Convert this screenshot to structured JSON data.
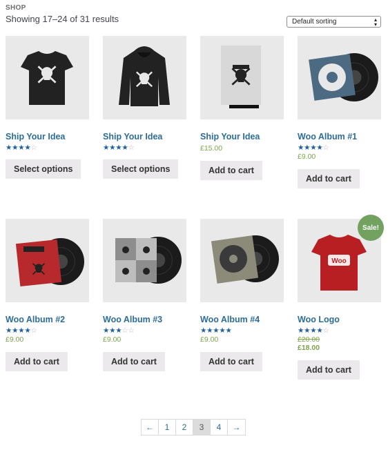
{
  "breadcrumb": "SHOP",
  "result_count": "Showing 17–24 of 31 results",
  "sort": {
    "selected": "Default sorting"
  },
  "sale_badge": "Sale!",
  "products": [
    {
      "name": "Ship Your Idea",
      "rating": 4.5,
      "price": "",
      "button": "Select options",
      "image": "black-tshirt"
    },
    {
      "name": "Ship Your Idea",
      "rating": 4,
      "price": "",
      "button": "Select options",
      "image": "black-hoodie"
    },
    {
      "name": "Ship Your Idea",
      "rating": 0,
      "price": "£15.00",
      "button": "Add to cart",
      "image": "poster"
    },
    {
      "name": "Woo Album #1",
      "rating": 4,
      "price": "£9.00",
      "button": "Add to cart",
      "image": "album-blue"
    },
    {
      "name": "Woo Album #2",
      "rating": 4,
      "price": "£9.00",
      "button": "Add to cart",
      "image": "album-red"
    },
    {
      "name": "Woo Album #3",
      "rating": 3,
      "price": "£9.00",
      "button": "Add to cart",
      "image": "album-grey"
    },
    {
      "name": "Woo Album #4",
      "rating": 5,
      "price": "£9.00",
      "button": "Add to cart",
      "image": "album-map"
    },
    {
      "name": "Woo Logo",
      "rating": 4,
      "old_price": "£20.00",
      "price": "£18.00",
      "button": "Add to cart",
      "image": "red-tshirt",
      "on_sale": true
    }
  ],
  "pagination": [
    "←",
    "1",
    "2",
    "3",
    "4",
    "→"
  ],
  "pagination_current": "3",
  "colors": {
    "link": "#2c6c9a",
    "price": "#7da34b",
    "sale": "#72a160",
    "button_bg": "#ebe9eb"
  }
}
